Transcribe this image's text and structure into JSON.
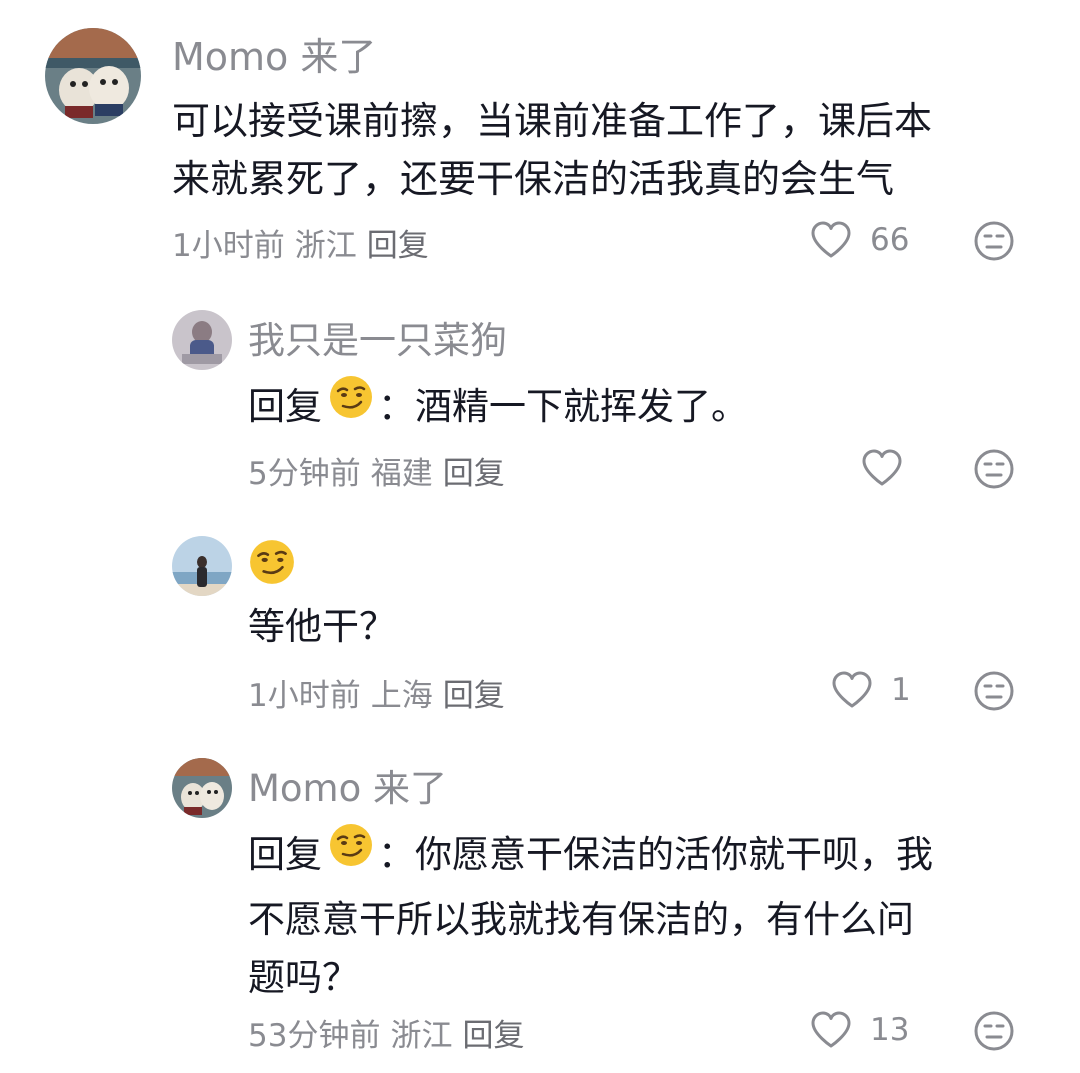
{
  "comments": [
    {
      "author": "Momo 来了",
      "text_line1": "可以接受课前擦，当课前准备工作了，课后本",
      "text_line2": "来就累死了，还要干保洁的活我真的会生气",
      "time": "1小时前",
      "location": "浙江",
      "reply_label": "回复",
      "likes": "66"
    },
    {
      "author": "我只是一只菜狗",
      "reply_prefix": "回复",
      "text": "：酒精一下就挥发了。",
      "time": "5分钟前",
      "location": "福建",
      "reply_label": "回复",
      "likes": ""
    },
    {
      "author_emoji": "smirk-emoji",
      "text": "等他干？",
      "time": "1小时前",
      "location": "上海",
      "reply_label": "回复",
      "likes": "1"
    },
    {
      "author": "Momo 来了",
      "reply_prefix": "回复",
      "text_line1": "：你愿意干保洁的活你就干呗，我",
      "text_line2": "不愿意干所以我就找有保洁的，有什么问",
      "text_line3": "题吗？",
      "time": "53分钟前",
      "location": "浙江",
      "reply_label": "回复",
      "likes": "13"
    }
  ],
  "icons": {
    "like": "heart-outline-icon",
    "dislike": "neutral-face-icon",
    "emoji": "smirk-emoji"
  },
  "colors": {
    "text": "#161823",
    "secondary": "#8a8b91",
    "emoji": "#f7c531"
  }
}
